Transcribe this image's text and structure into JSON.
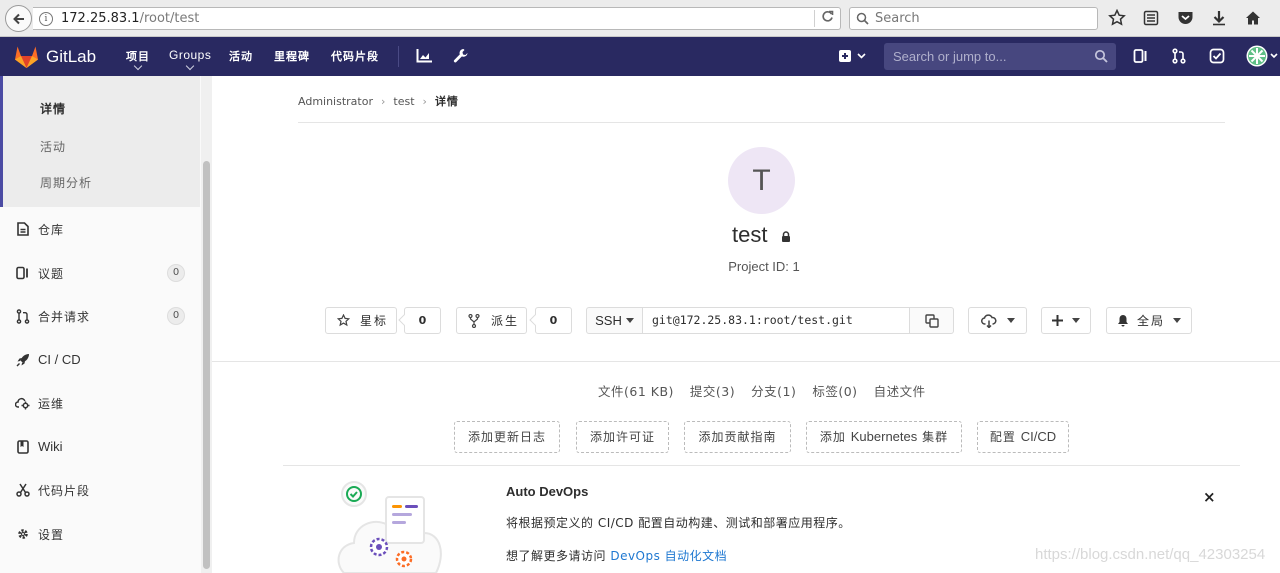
{
  "browser": {
    "url_host": "172.25.83.1",
    "url_path": "/root/test",
    "search_placeholder": "Search"
  },
  "gitlab_header": {
    "brand": "GitLab",
    "nav": [
      "项目",
      "Groups",
      "活动",
      "里程碑",
      "代码片段"
    ],
    "search_placeholder": "Search or jump to..."
  },
  "sidebar": {
    "sub_items": [
      {
        "label": "详情",
        "active": true
      },
      {
        "label": "活动",
        "active": false
      },
      {
        "label": "周期分析",
        "active": false
      }
    ],
    "items": [
      {
        "label": "仓库",
        "icon": "doc-icon"
      },
      {
        "label": "议题",
        "icon": "issues-icon",
        "badge": "0"
      },
      {
        "label": "合并请求",
        "icon": "merge-request-icon",
        "badge": "0"
      },
      {
        "label": "CI / CD",
        "icon": "rocket-icon"
      },
      {
        "label": "运维",
        "icon": "cloud-gear-icon"
      },
      {
        "label": "Wiki",
        "icon": "book-icon"
      },
      {
        "label": "代码片段",
        "icon": "scissors-icon"
      },
      {
        "label": "设置",
        "icon": "gear-icon"
      }
    ]
  },
  "breadcrumb": [
    "Administrator",
    "test",
    "详情"
  ],
  "project": {
    "avatar_letter": "T",
    "name": "test",
    "id_text": "Project ID: 1"
  },
  "actions": {
    "star_label": "星标",
    "star_count": "0",
    "fork_label": "派生",
    "fork_count": "0",
    "clone_protocol": "SSH",
    "clone_url": "git@172.25.83.1:root/test.git",
    "notification_label": "全局"
  },
  "stats": [
    "文件(61 KB)",
    "提交(3)",
    "分支(1)",
    "标签(0)",
    "自述文件"
  ],
  "add_buttons": {
    "changelog": "添加更新日志",
    "license": "添加许可证",
    "contrib": "添加贡献指南",
    "k8s_prefix": "添加 ",
    "k8s_en": "Kubernetes",
    "k8s_suffix": " 集群",
    "cicd_prefix": "配置 ",
    "cicd_en": "CI/CD"
  },
  "devops": {
    "title": "Auto DevOps",
    "description": "将根据预定义的 CI/CD 配置自动构建、测试和部署应用程序。",
    "more_prefix": "想了解更多请访问 ",
    "more_link": "DevOps 自动化文档",
    "close": "×"
  },
  "watermark": "https://blog.csdn.net/qq_42303254"
}
